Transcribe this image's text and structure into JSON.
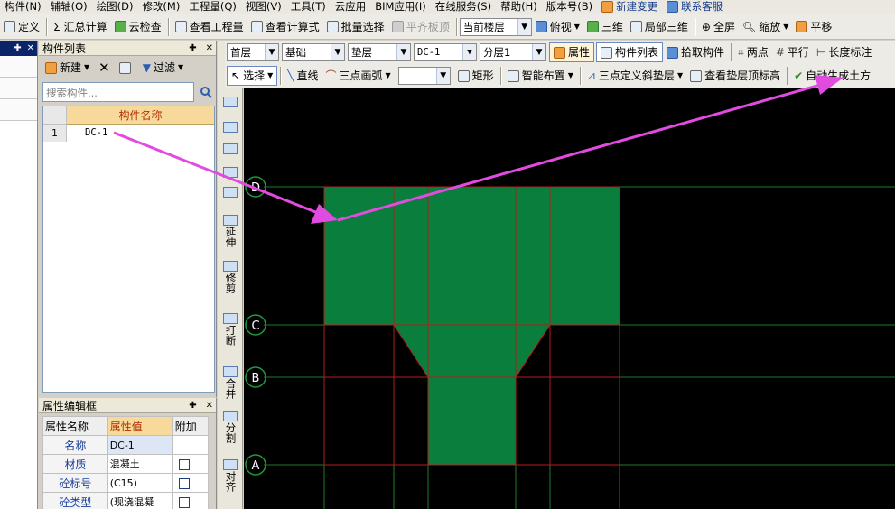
{
  "menu": [
    {
      "label": "构件(N)",
      "style": "plain"
    },
    {
      "label": "辅轴(O)",
      "style": "plain"
    },
    {
      "label": "绘图(D)",
      "style": "plain"
    },
    {
      "label": "修改(M)",
      "style": "plain"
    },
    {
      "label": "工程量(Q)",
      "style": "plain"
    },
    {
      "label": "视图(V)",
      "style": "plain"
    },
    {
      "label": "工具(T)",
      "style": "plain"
    },
    {
      "label": "云应用",
      "style": "plain"
    },
    {
      "label": "BIM应用(I)",
      "style": "plain"
    },
    {
      "label": "在线服务(S)",
      "style": "plain"
    },
    {
      "label": "帮助(H)",
      "style": "plain"
    },
    {
      "label": "版本号(B)",
      "style": "plain"
    },
    {
      "label": "新建变更",
      "style": "blue"
    },
    {
      "label": "联系客服",
      "style": "blue"
    }
  ],
  "toolbar1": {
    "define": "定义",
    "sum": "汇总计算",
    "cloud_check": "云检查",
    "view_qty": "查看工程量",
    "view_formula": "查看计算式",
    "batch_select": "批量选择",
    "flat_slab": "平齐板顶",
    "floor_combo": "当前楼层",
    "view": "俯视",
    "three_d": "三维",
    "local_3d": "局部三维",
    "fullscreen": "全屏",
    "zoom": "缩放",
    "pan": "平移"
  },
  "component_list": {
    "title": "构件列表",
    "new": "新建",
    "filter": "过滤",
    "search_placeholder": "搜索构件...",
    "column": "构件名称",
    "rows": [
      {
        "index": "1",
        "name": "DC-1"
      }
    ]
  },
  "property_editor": {
    "title": "属性编辑框",
    "headers": {
      "name": "属性名称",
      "value": "属性值",
      "extra": "附加"
    },
    "rows": [
      {
        "name": "名称",
        "value": "DC-1",
        "checkbox": false
      },
      {
        "name": "材质",
        "value": "混凝土",
        "checkbox": true
      },
      {
        "name": "砼标号",
        "value": "(C15)",
        "checkbox": true
      },
      {
        "name": "砼类型",
        "value": "(现浇混凝",
        "checkbox": true
      }
    ]
  },
  "side_tools": [
    "延伸",
    "修剪",
    "打断",
    "合并",
    "分割",
    "对齐"
  ],
  "cad_toolbar": {
    "combos": [
      "首层",
      "基础",
      "垫层",
      "DC-1",
      "分层1"
    ],
    "property": "属性",
    "comp_list": "构件列表",
    "pick": "拾取构件",
    "two_points": "两点",
    "parallel": "平行",
    "length_mark": "长度标注",
    "select": "选择",
    "line": "直线",
    "arc": "三点画弧",
    "rect": "矩形",
    "smart": "智能布置",
    "slope": "三点定义斜垫层",
    "view_top": "查看垫层顶标高",
    "auto_gen": "自动生成土方"
  },
  "axis_labels": {
    "d": "D",
    "c": "C",
    "b": "B",
    "a": "A"
  },
  "colors": {
    "fill": "#0a7e3c",
    "grid_red": "#b31d1d",
    "grid_green": "#1e7a2a",
    "arrow": "#e24be0"
  }
}
